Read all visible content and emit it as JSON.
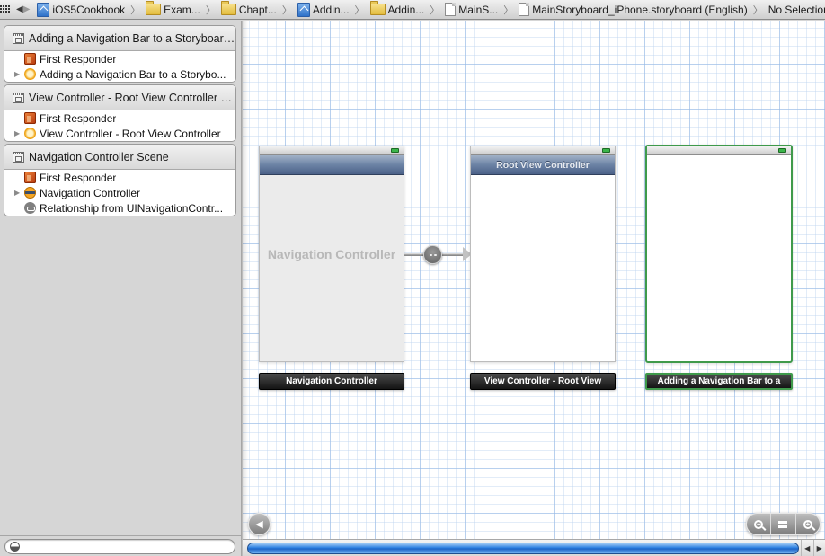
{
  "jumpbar": {
    "grid_icon": "related-items-grid-icon",
    "back_label": "◀",
    "forward_label": "▶",
    "crumbs": [
      {
        "label": "iOS5Cookbook",
        "icon": "project-icon"
      },
      {
        "label": "Exam...",
        "icon": "folder-icon"
      },
      {
        "label": "Chapt...",
        "icon": "folder-icon"
      },
      {
        "label": "Addin...",
        "icon": "project-icon"
      },
      {
        "label": "Addin...",
        "icon": "folder-icon"
      },
      {
        "label": "MainS...",
        "icon": "file-icon"
      },
      {
        "label": "MainStoryboard_iPhone.storyboard (English)",
        "icon": "file-icon"
      },
      {
        "label": "No Selection",
        "icon": null
      }
    ],
    "separator": "〉"
  },
  "outline": {
    "scenes": [
      {
        "title": "Adding a Navigation Bar to a Storyboard...",
        "rows": [
          {
            "label": "First Responder",
            "icon": "first-responder-icon",
            "expandable": false
          },
          {
            "label": "Adding a Navigation Bar to a Storybo...",
            "icon": "view-controller-icon",
            "expandable": true
          }
        ]
      },
      {
        "title": "View Controller - Root View Controller S...",
        "rows": [
          {
            "label": "First Responder",
            "icon": "first-responder-icon",
            "expandable": false
          },
          {
            "label": "View Controller - Root View Controller",
            "icon": "view-controller-icon",
            "expandable": true
          }
        ]
      },
      {
        "title": "Navigation Controller Scene",
        "rows": [
          {
            "label": "First Responder",
            "icon": "first-responder-icon",
            "expandable": false
          },
          {
            "label": "Navigation Controller",
            "icon": "navigation-controller-icon",
            "expandable": true
          },
          {
            "label": "Relationship from UINavigationContr...",
            "icon": "relationship-icon",
            "expandable": false
          }
        ]
      }
    ],
    "disclosure_glyph": "▶",
    "filter": {
      "value": "",
      "placeholder": ""
    }
  },
  "canvas": {
    "nav_controller": {
      "body_label": "Navigation Controller",
      "scene_label": "Navigation Controller"
    },
    "root_view_controller": {
      "nav_title": "Root View Controller",
      "scene_label": "View Controller - Root View"
    },
    "adding_view_controller": {
      "scene_label": "Adding a Navigation Bar to a",
      "selected": true
    },
    "segue": {
      "type": "relationship"
    },
    "colors": {
      "selection": "#3f9a4b",
      "navbar": "#6c83a5",
      "battery": "#3bb54a"
    },
    "back_label": "◀",
    "zoom_out_label": "−",
    "zoom_fit_label": "=",
    "zoom_in_label": "+"
  },
  "scroller": {
    "left_arrow": "◀",
    "right_arrow": "▶"
  }
}
